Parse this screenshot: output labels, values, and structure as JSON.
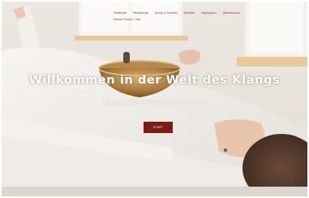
{
  "nav": {
    "items": [
      "Startseite",
      "Wirkprinzip",
      "Kurse & Termine",
      "Kontakt",
      "Impressum",
      "Datenschutz"
    ],
    "second_row": "Meine Person / Vita"
  },
  "hero": {
    "title": "Willkommen in der Welt des Klangs",
    "subtitle": "Klangschalen-Massage und Meditation",
    "cta_label": "START"
  },
  "colors": {
    "accent": "#7d1b17",
    "nav_text": "#8b2a23"
  }
}
